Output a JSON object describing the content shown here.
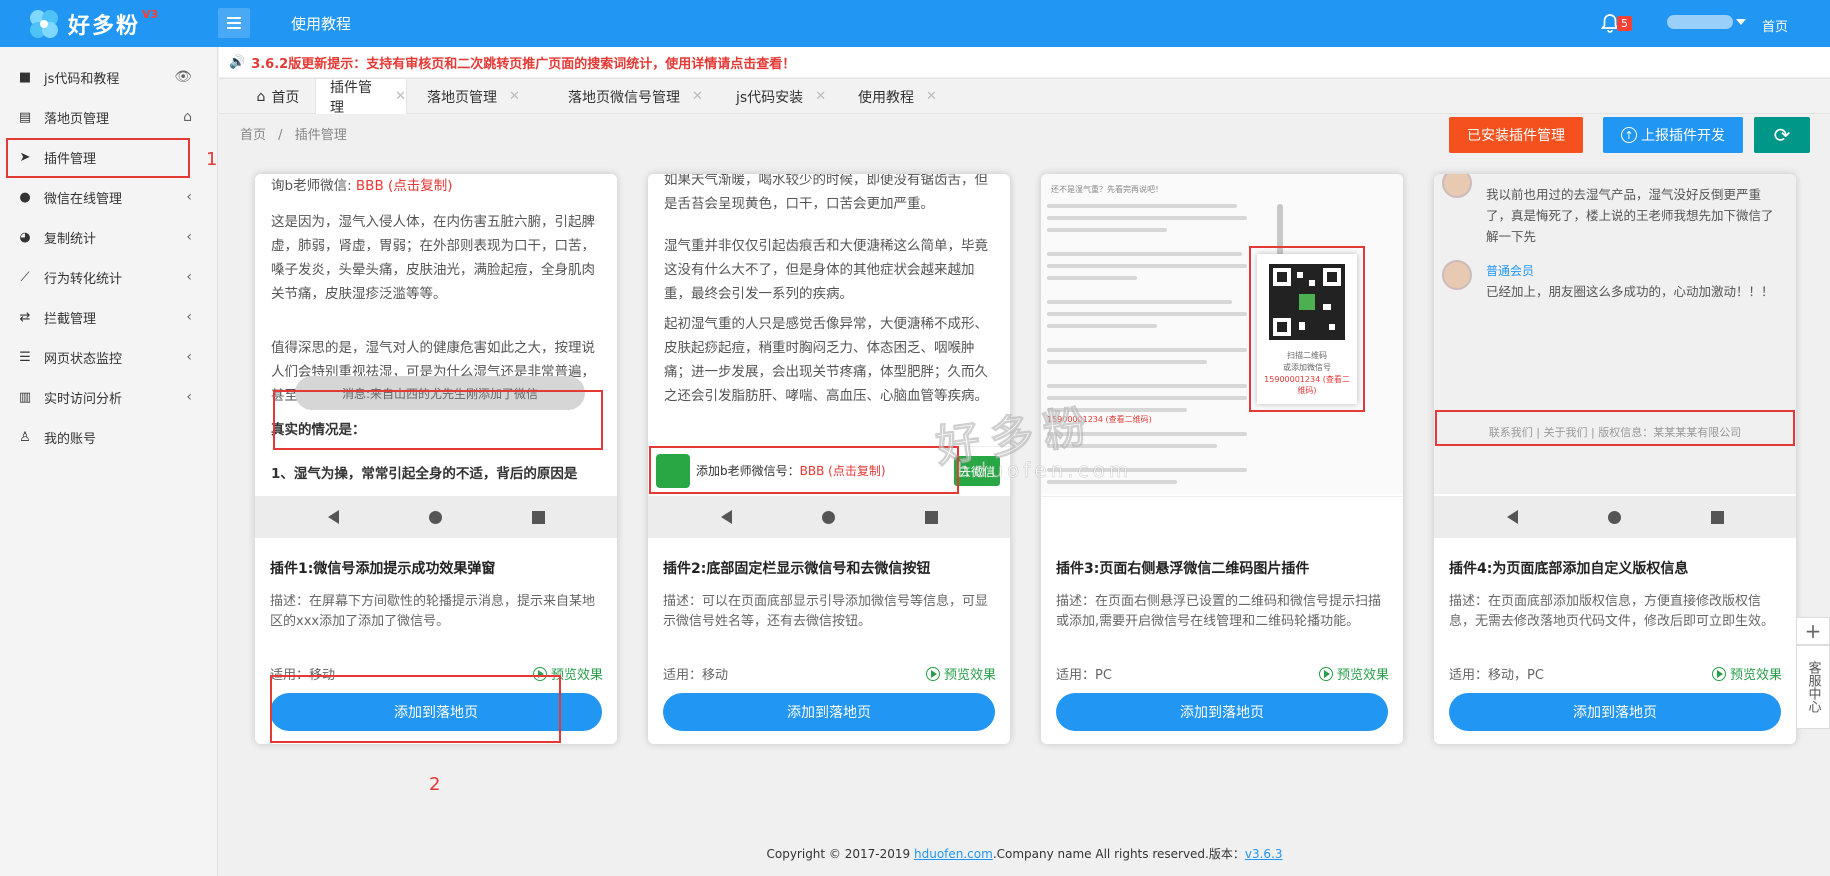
{
  "app": {
    "logo_text": "好多粉",
    "logo_version": "V3",
    "top_title": "使用教程",
    "notification_count": "5",
    "home_link": "首页"
  },
  "sidebar": {
    "items": [
      {
        "icon": "bookmark-icon",
        "label": "js代码和教程",
        "right": "eye-icon"
      },
      {
        "icon": "document-icon",
        "label": "落地页管理",
        "right": "home-icon"
      },
      {
        "icon": "send-icon",
        "label": "插件管理",
        "right": ""
      },
      {
        "icon": "wechat-icon",
        "label": "微信在线管理",
        "right": "chevron-left-icon"
      },
      {
        "icon": "pie-chart-icon",
        "label": "复制统计",
        "right": "chevron-left-icon"
      },
      {
        "icon": "line-chart-icon",
        "label": "行为转化统计",
        "right": "chevron-left-icon"
      },
      {
        "icon": "exchange-icon",
        "label": "拦截管理",
        "right": "chevron-left-icon"
      },
      {
        "icon": "server-icon",
        "label": "网页状态监控",
        "right": "chevron-left-icon"
      },
      {
        "icon": "bar-chart-icon",
        "label": "实时访问分析",
        "right": "chevron-left-icon"
      },
      {
        "icon": "user-icon",
        "label": "我的账号",
        "right": ""
      }
    ]
  },
  "annotations": {
    "num1": "1",
    "num2": "2"
  },
  "notice": {
    "text": "3.6.2版更新提示：支持有审核页和二次跳转页推广页面的搜索词统计，使用详情请点击查看！"
  },
  "tabs": [
    {
      "label": "首页"
    },
    {
      "label": "插件管理"
    },
    {
      "label": "落地页管理"
    },
    {
      "label": "落地页微信号管理"
    },
    {
      "label": "js代码安装"
    },
    {
      "label": "使用教程"
    }
  ],
  "breadcrumb": {
    "home": "首页",
    "sep": "/",
    "current": "插件管理"
  },
  "actions": {
    "installed": "已安装插件管理",
    "report": "上报插件开发",
    "refresh": "refresh-icon"
  },
  "plugin1": {
    "line1a": "询b老师微信: ",
    "line1b": "BBB (点击复制)",
    "para1": "这是因为，湿气入侵人体，在内伤害五脏六腑，引起脾虚，肺弱，肾虚，胃弱；在外部则表现为口干，口苦，嗓子发炎，头晕头痛，皮肤油光，满脸起痘，全身肌肉关节痛，皮肤湿疹泛滥等等。",
    "para2": "值得深思的是，湿气对人的健康危害如此之大，按理说人们会特别重视祛湿，可是为什么湿气还是非常普遍，甚至十人九湿呢？",
    "toast": "消息:来自山西的尤先生刚添加了微信",
    "heading": "真实的情况是：",
    "para3": "1、湿气为操，常常引起全身的不适，背后的原因是",
    "title": "插件1:微信号添加提示成功效果弹窗",
    "desc": "描述：在屏幕下方间歇性的轮播提示消息，提示来自某地区的xxx添加了添加了微信号。",
    "fit": "适用：移动",
    "preview": "预览效果",
    "add": "添加到落地页"
  },
  "plugin2": {
    "para1": "如果天气渐暖，喝水较少的时候，即便没有锯齿舌，但是舌苔会呈现黄色，口干，口苦会更加严重。",
    "para2": "湿气重并非仅仅引起齿痕舌和大便溏稀这么简单，毕竟这没有什么大不了，但是身体的其他症状会越来越加重，最终会引发一系列的疾病。",
    "para3": "起初湿气重的人只是感觉舌像异常，大便溏稀不成形、皮肤起痧起痘，稍重时胸闷乏力、体态困乏、咽喉肿痛；进一步发展，会出现关节疼痛，体型肥胖；久而久之还会引发脂肪肝、哮喘、高血压、心脑血管等疾病。",
    "wx_label": "添加b老师微信号：",
    "wx_id": "BBB (点击复制)",
    "wx_btn": "去微信",
    "title": "插件2:底部固定栏显示微信号和去微信按钮",
    "desc": "描述：可以在页面底部显示引导添加微信号等信息，可显示微信号姓名等，还有去微信按钮。",
    "fit": "适用：移动",
    "preview": "预览效果",
    "add": "添加到落地页"
  },
  "plugin3": {
    "top_text": "还不是湿气重？先看完再说吧！",
    "qr_caption": "扫描二维码",
    "qr_caption2": "或添加微信号",
    "qr_number": "15900001234 (查看二维码)",
    "bottom_red": "15900001234 (查看二维码)",
    "title": "插件3:页面右侧悬浮微信二维码图片插件",
    "desc": "描述：在页面右侧悬浮已设置的二维码和微信号提示扫描或添加,需要开启微信号在线管理和二维码轮播功能。",
    "fit": "适用：PC",
    "preview": "预览效果",
    "add": "添加到落地页"
  },
  "plugin4": {
    "comment1": "我以前也用过的去湿气产品，湿气没好反倒更严重了，真是悔死了，楼上说的王老师我想先加下微信了解一下先",
    "member": "普通会员",
    "comment2": "已经加上，朋友圈这么多成功的，心动加激动！！！",
    "footer": "联系我们 | 关于我们 | 版权信息：某某某某有限公司",
    "title": "插件4:为页面底部添加自定义版权信息",
    "desc": "描述：在页面底部添加版权信息，方便直接修改版权信息，无需去修改落地页代码文件，修改后即可立即生效。",
    "fit": "适用：移动，PC",
    "preview": "预览效果",
    "add": "添加到落地页"
  },
  "watermark": {
    "line1": "好多粉",
    "line2": "hduofen.com"
  },
  "footer": {
    "prefix": "Copyright © 2017-2019 ",
    "link": "hduofen.com",
    "middle": ".Company name All rights reserved.版本：",
    "version": "v3.6.3"
  },
  "float": {
    "add": "+",
    "service": "客服中心"
  },
  "colors": {
    "primary": "#2196f3",
    "accent_red": "#e53935",
    "orange": "#f4511e",
    "teal": "#009688",
    "wechat_green": "#29a745"
  }
}
